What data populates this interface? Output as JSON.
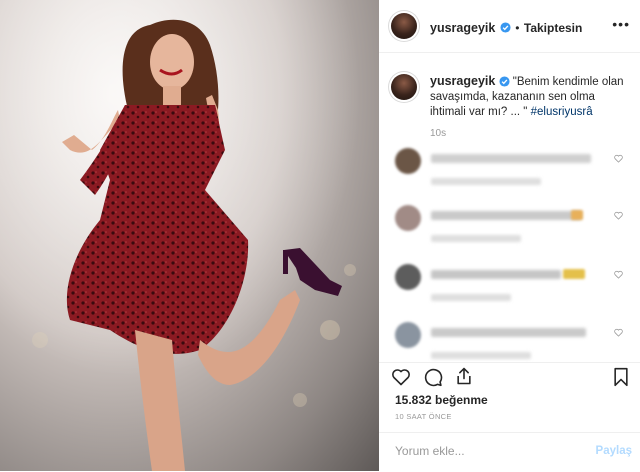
{
  "header": {
    "username": "yusrageyik",
    "separator": "•",
    "follow_label": "Takiptesin"
  },
  "caption": {
    "username": "yusrageyik",
    "text": "\"Benim kendimle olan savaşımda, kazananın sen olma ihtimali var mı? ... \"",
    "hashtag": "#elusriyusrâ",
    "time": "10s"
  },
  "comments": [
    {
      "avatar_color": "#6b5646"
    },
    {
      "avatar_color": "#a18b86"
    },
    {
      "avatar_color": "#5d5d5d"
    },
    {
      "avatar_color": "#8a94a0"
    }
  ],
  "actions": {
    "like_icon": "heart-icon",
    "comment_icon": "comment-icon",
    "share_icon": "share-icon",
    "save_icon": "bookmark-icon"
  },
  "likes_text": "15.832 beğenme",
  "time_ago": "10 SAAT ÖNCE",
  "comment_box": {
    "placeholder": "Yorum ekle...",
    "post_label": "Paylaş"
  },
  "colors": {
    "accent": "#0095f6",
    "verified": "#3897f0",
    "dress": "#8b1a22",
    "muted": "#999999"
  }
}
